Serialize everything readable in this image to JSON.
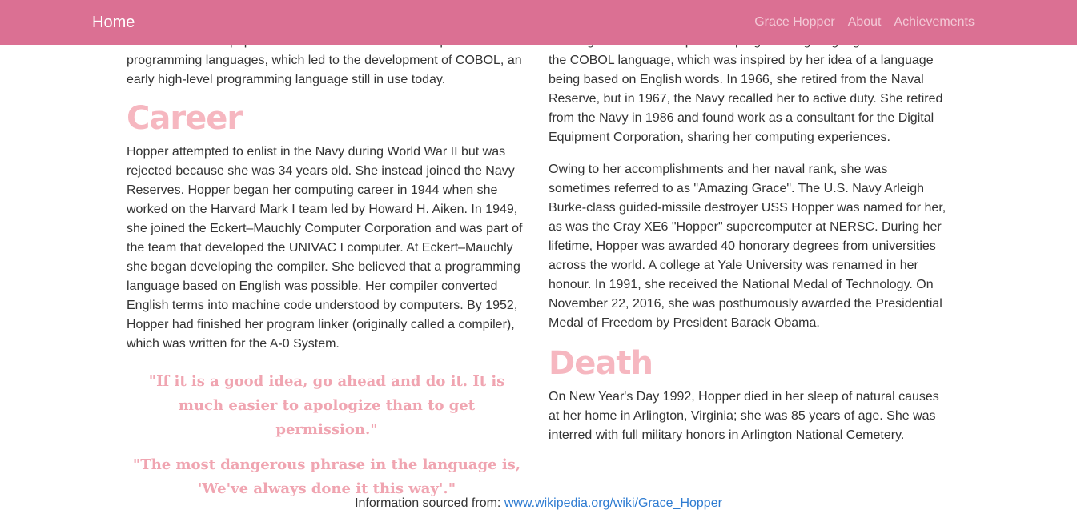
{
  "navbar": {
    "brand": "Home",
    "links": [
      "Grace Hopper",
      "About",
      "Achievements"
    ]
  },
  "left_column": {
    "intro_tail_lines": [
      "related tools. She popularised the idea of machine-independent",
      "programming languages, which led to the development of COBOL, an",
      "early high-level programming language still in use today."
    ],
    "career_heading": "Career",
    "career_paragraph": "Hopper attempted to enlist in the Navy during World War II but was rejected because she was 34 years old. She instead joined the Navy Reserves. Hopper began her computing career in 1944 when she worked on the Harvard Mark I team led by Howard H. Aiken. In 1949, she joined the Eckert–Mauchly Computer Corporation and was part of the team that developed the UNIVAC I computer. At Eckert–Mauchly she began developing the compiler. She believed that a programming language based on English was possible. Her compiler converted English terms into machine code understood by computers. By 1952, Hopper had finished her program linker (originally called a compiler), which was written for the A-0 System.",
    "quotes": [
      "\"If it is a good idea, go ahead and do it. It is much easier to apologize than to get permission.\"",
      "\"The most dangerous phrase in the language is, 'We've always done it this way'.\""
    ]
  },
  "right_column": {
    "para1_tail_lines": [
      "creating a machine-independent programming language. This led to",
      "the COBOL language, which was inspired by her idea of a language being based on English words. In 1966, she retired from the Naval Reserve, but in 1967, the Navy recalled her to active duty. She retired from the Navy in 1986 and found work as a consultant for the Digital Equipment Corporation, sharing her computing experiences."
    ],
    "para2": "Owing to her accomplishments and her naval rank, she was sometimes referred to as \"Amazing Grace\". The U.S. Navy Arleigh Burke-class guided-missile destroyer USS Hopper was named for her, as was the Cray XE6 \"Hopper\" supercomputer at NERSC. During her lifetime, Hopper was awarded 40 honorary degrees from universities across the world. A college at Yale University was renamed in her honour. In 1991, she received the National Medal of Technology. On November 22, 2016, she was posthumously awarded the Presidential Medal of Freedom by President Barack Obama.",
    "death_heading": "Death",
    "death_paragraph": "On New Year's Day 1992, Hopper died in her sleep of natural causes at her home in Arlington, Virginia; she was 85 years of age. She was interred with full military honors in Arlington National Cemetery."
  },
  "footer": {
    "label": "Information sourced from:",
    "link_text": "www.wikipedia.org/wiki/Grace_Hopper"
  },
  "colors": {
    "navbar_bg": "#db7093",
    "heading_pink": "#f6b7c0",
    "quote_pink": "#f0a5b1",
    "link_blue": "#2d7bd1"
  }
}
